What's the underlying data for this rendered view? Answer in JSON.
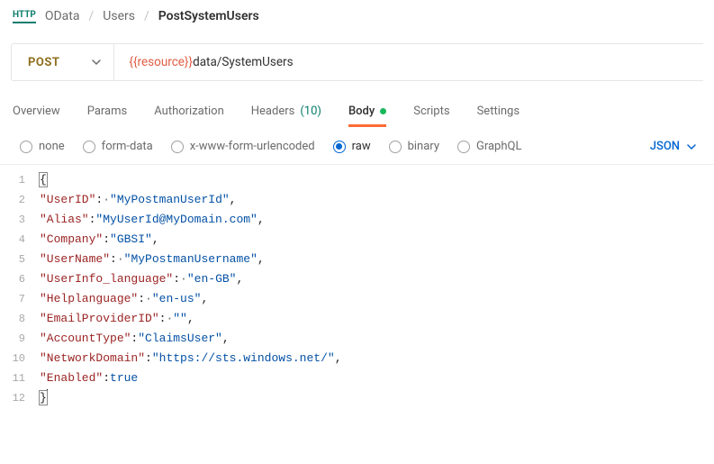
{
  "breadcrumb": {
    "parts": [
      "OData",
      "Users"
    ],
    "current": "PostSystemUsers",
    "badge": "HTTP"
  },
  "request": {
    "method": "POST",
    "url_var": "{{resource}}",
    "url_rest": "data/SystemUsers"
  },
  "tabs": {
    "overview": "Overview",
    "params": "Params",
    "auth": "Authorization",
    "headers_label": "Headers",
    "headers_count": "(10)",
    "body": "Body",
    "scripts": "Scripts",
    "settings": "Settings"
  },
  "body_types": {
    "none": "none",
    "formdata": "form-data",
    "xwww": "x-www-form-urlencoded",
    "raw": "raw",
    "binary": "binary",
    "graphql": "GraphQL",
    "language": "JSON"
  },
  "editor": {
    "lines": [
      {
        "n": "1",
        "html": "<span class='brace-hl pun'>{</span>"
      },
      {
        "n": "2",
        "html": "<span class='key'>\"UserID\"</span><span class='pun'>:</span><span class='sp'>·</span><span class='str'>\"MyPostmanUserId\"</span><span class='pun'>,</span>"
      },
      {
        "n": "3",
        "html": "<span class='key'>\"Alias\"</span><span class='pun'>:</span><span class='str'>\"MyUserId@MyDomain.com\"</span><span class='pun'>,</span>"
      },
      {
        "n": "4",
        "html": "<span class='key'>\"Company\"</span><span class='pun'>:</span><span class='str'>\"GBSI\"</span><span class='pun'>,</span>"
      },
      {
        "n": "5",
        "html": "<span class='key'>\"UserName\"</span><span class='pun'>:</span><span class='sp'>·</span><span class='str'>\"MyPostmanUsername\"</span><span class='pun'>,</span>"
      },
      {
        "n": "6",
        "html": "<span class='key'>\"UserInfo_language\"</span><span class='pun'>:</span><span class='sp'>·</span><span class='str'>\"en-GB\"</span><span class='pun'>,</span>"
      },
      {
        "n": "7",
        "html": "<span class='key'>\"Helplanguage\"</span><span class='pun'>:</span><span class='sp'>·</span><span class='str'>\"en-us\"</span><span class='pun'>,</span>"
      },
      {
        "n": "8",
        "html": "<span class='key'>\"EmailProviderID\"</span><span class='pun'>:</span><span class='sp'>·</span><span class='str'>\"\"</span><span class='pun'>,</span>"
      },
      {
        "n": "9",
        "html": "<span class='key'>\"AccountType\"</span><span class='pun'>:</span><span class='str'>\"ClaimsUser\"</span><span class='pun'>,</span>"
      },
      {
        "n": "10",
        "html": "<span class='key'>\"NetworkDomain\"</span><span class='pun'>:</span><span class='str'>\"https://sts.windows.net/\"</span><span class='pun'>,</span>"
      },
      {
        "n": "11",
        "html": "<span class='key'>\"Enabled\"</span><span class='pun'>:</span><span class='bool'>true</span>"
      },
      {
        "n": "12",
        "html": "<span class='brace-hl pun'>}</span><span class='caret'></span>"
      }
    ]
  }
}
